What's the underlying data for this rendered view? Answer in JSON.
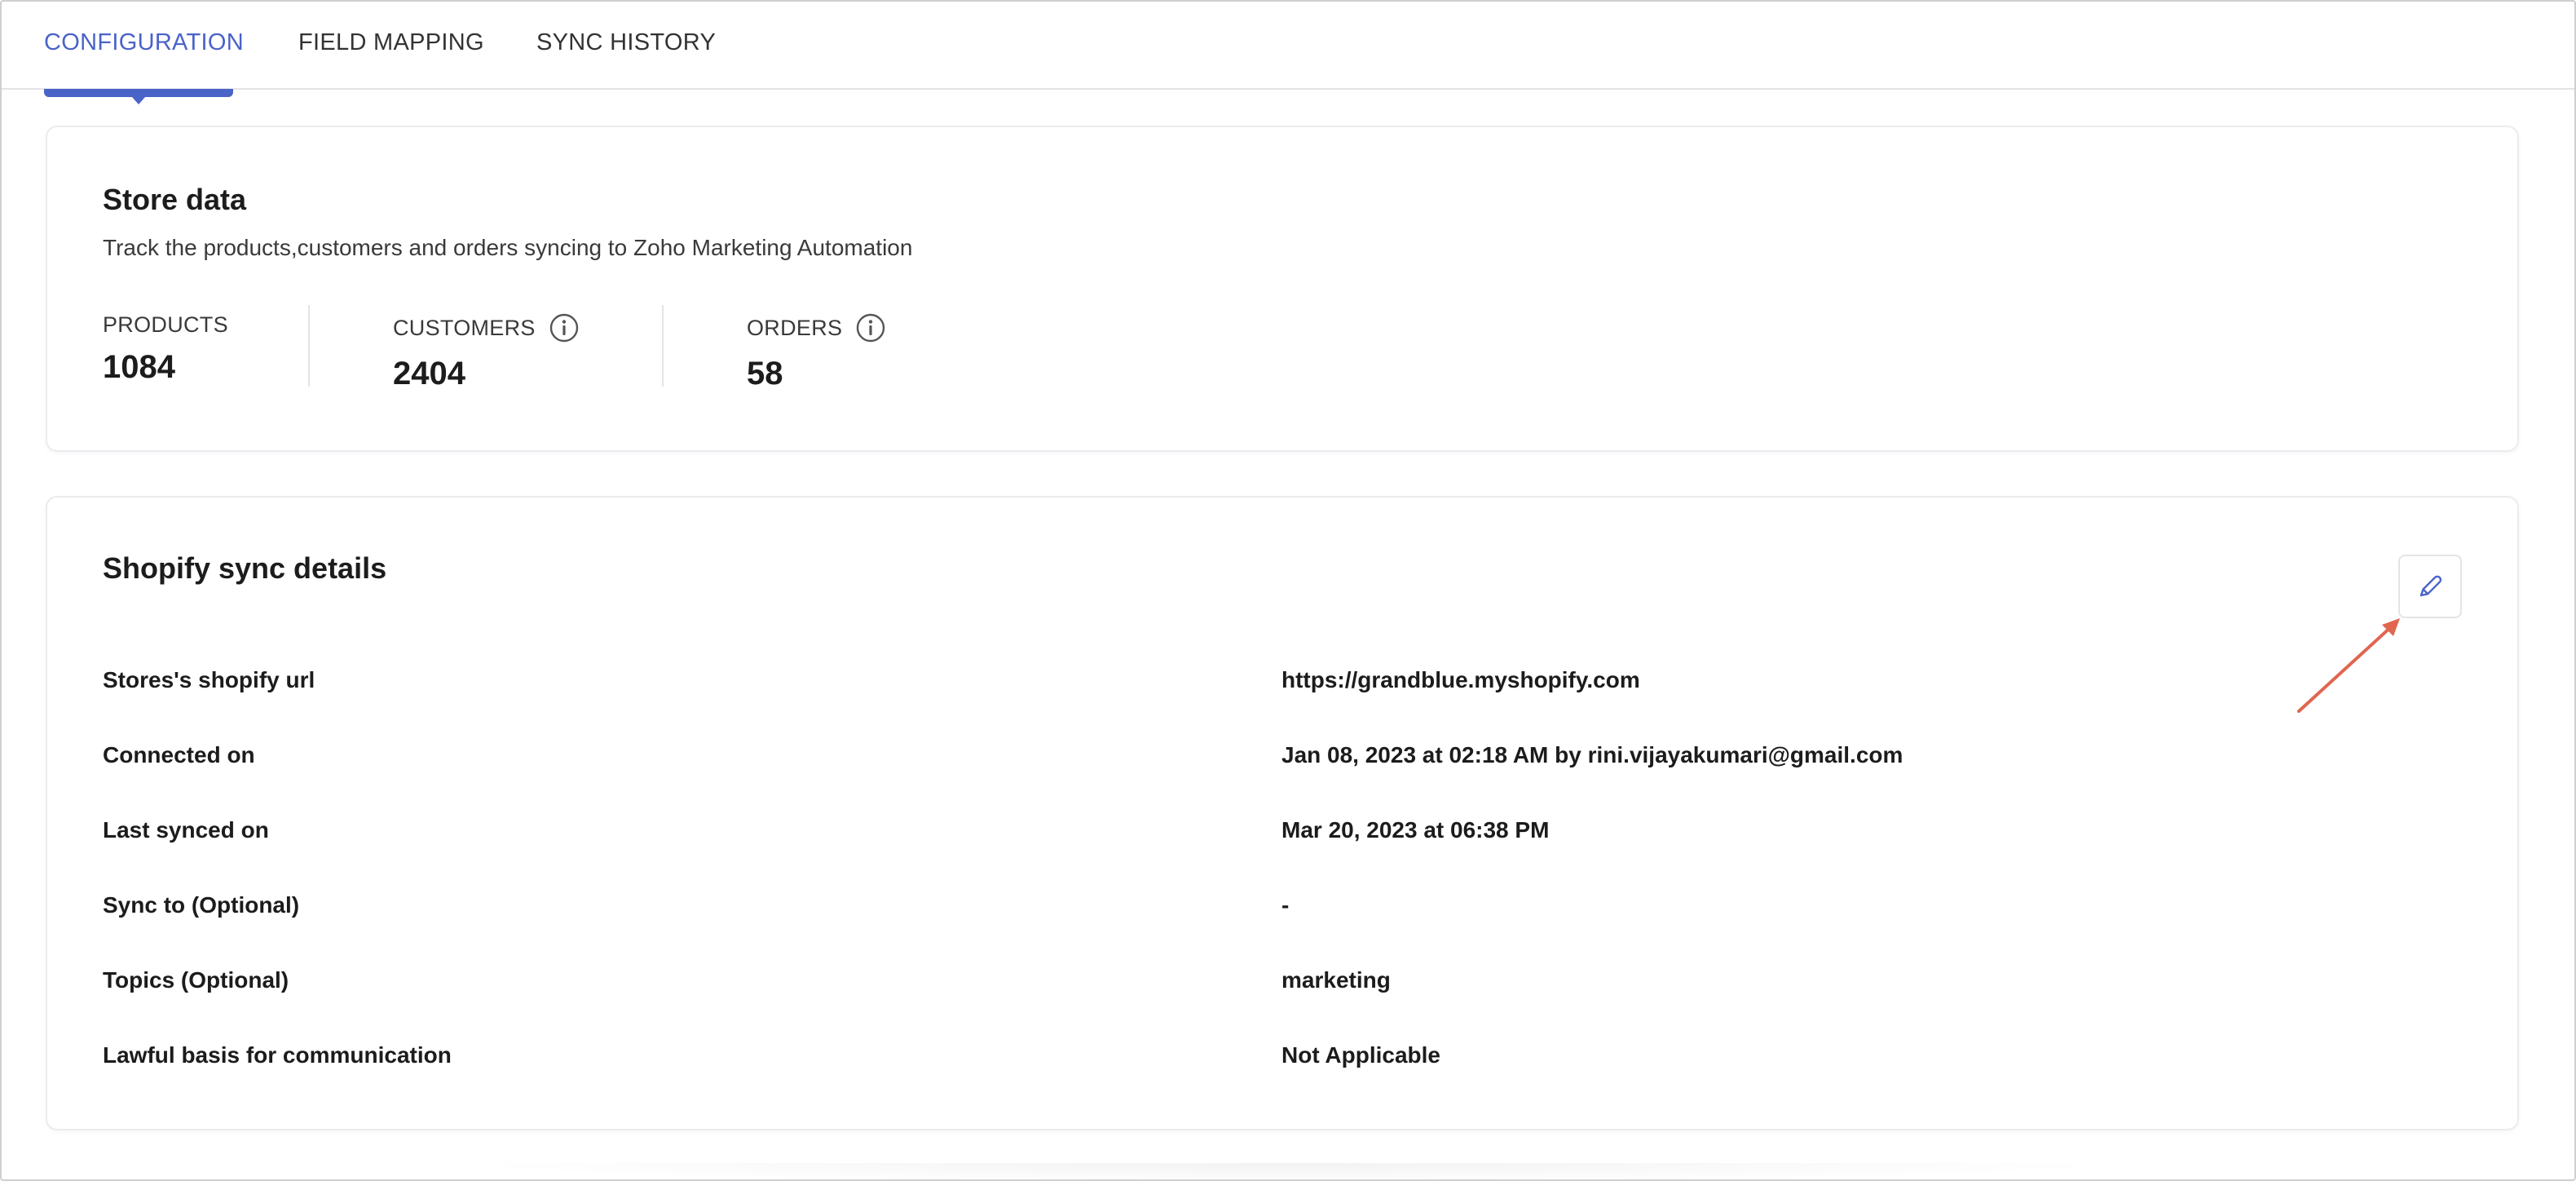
{
  "tabs": [
    {
      "label": "CONFIGURATION",
      "active": true
    },
    {
      "label": "FIELD MAPPING",
      "active": false
    },
    {
      "label": "SYNC HISTORY",
      "active": false
    }
  ],
  "store_data": {
    "title": "Store data",
    "subtitle": "Track the products,customers and orders syncing to Zoho Marketing Automation",
    "stats": [
      {
        "label": "PRODUCTS",
        "value": "1084",
        "info_icon": false
      },
      {
        "label": "CUSTOMERS",
        "value": "2404",
        "info_icon": true
      },
      {
        "label": "ORDERS",
        "value": "58",
        "info_icon": true
      }
    ]
  },
  "sync_details": {
    "title": "Shopify sync details",
    "edit_icon": "pencil-icon",
    "rows": [
      {
        "label": "Stores's shopify url",
        "value": "https://grandblue.myshopify.com"
      },
      {
        "label": "Connected on",
        "value": "Jan 08, 2023 at 02:18 AM by rini.vijayakumari@gmail.com"
      },
      {
        "label": "Last synced on",
        "value": "Mar 20, 2023 at 06:38 PM"
      },
      {
        "label": "Sync to (Optional)",
        "value": "-"
      },
      {
        "label": "Topics (Optional)",
        "value": "marketing"
      },
      {
        "label": "Lawful basis for communication",
        "value": "Not Applicable"
      }
    ]
  },
  "colors": {
    "accent": "#4a63c8",
    "annotation_arrow": "#e06650",
    "border": "#e4e4e8"
  }
}
